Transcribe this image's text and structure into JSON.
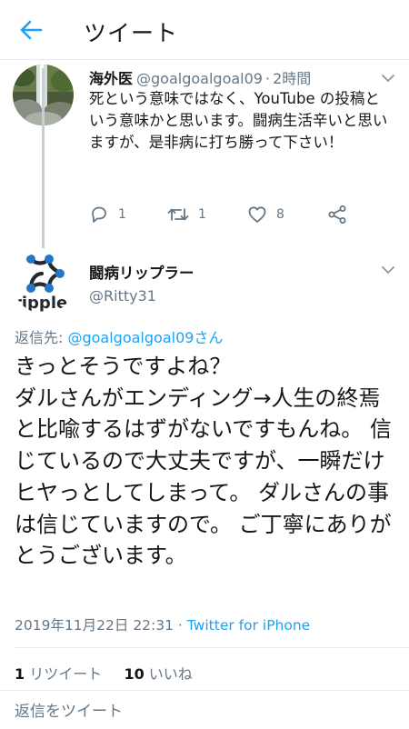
{
  "header": {
    "title": "ツイート"
  },
  "parent_tweet": {
    "name": "海外医",
    "handle": "@goalgoalgoal09",
    "separator": "·",
    "time": "2時間",
    "text": "死という意味ではなく、YouTube の投稿という意味かと思います。闘病生活辛いと思いますが、是非病に打ち勝って下さい！",
    "reply_count": "1",
    "retweet_count": "1",
    "like_count": "8"
  },
  "main_tweet": {
    "name": "闘病リップラー",
    "handle": "@Ritty31",
    "avatar_text": "ripple",
    "reply_prefix": "返信先: ",
    "reply_mention": "@goalgoalgoal09さん",
    "text": "きっとそうですよね？\nダルさんがエンディング→人生の終焉と比喩するはずがないですもんね。 信じているので大丈夫ですが、一瞬だけヒヤっとしてしまって。 ダルさんの事は信じていますので。 ご丁寧にありがとうございます。",
    "timestamp": "2019年11月22日 22:31",
    "meta_separator": " · ",
    "client": "Twitter for iPhone",
    "retweets_count": "1",
    "retweets_label": "リツイート",
    "likes_count": "10",
    "likes_label": "いいね"
  },
  "reply_box": {
    "placeholder": "返信をツイート"
  },
  "colors": {
    "accent": "#1da1f2",
    "secondary_text": "#657786",
    "divider": "#e6ecf0",
    "ripple_blue": "#23292f"
  }
}
